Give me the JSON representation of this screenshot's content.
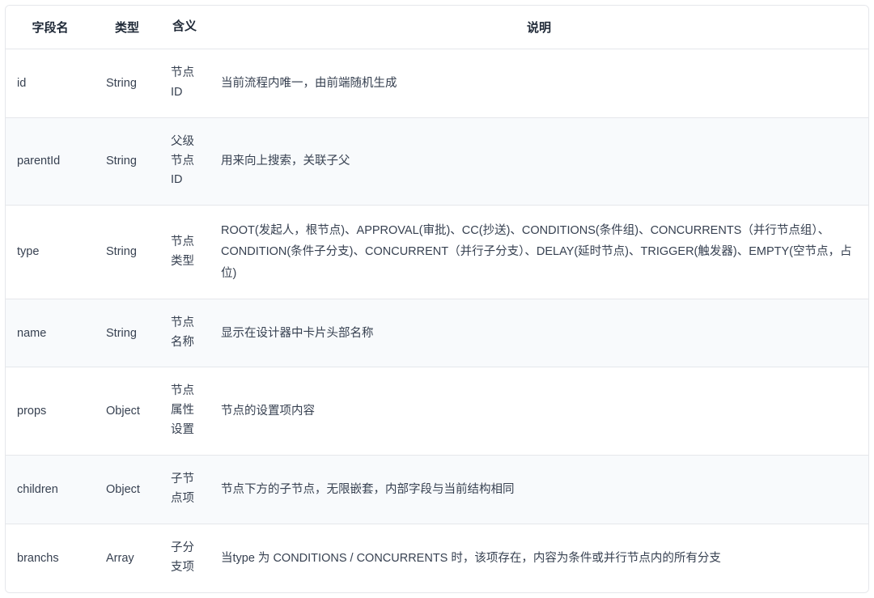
{
  "headers": {
    "field": "字段名",
    "type": "类型",
    "meaning": "含义",
    "description": "说明"
  },
  "rows": [
    {
      "field": "id",
      "type": "String",
      "meaning": "节点ID",
      "description": "当前流程内唯一，由前端随机生成"
    },
    {
      "field": "parentId",
      "type": "String",
      "meaning": "父级节点ID",
      "description": "用来向上搜索，关联子父"
    },
    {
      "field": "type",
      "type": "String",
      "meaning": "节点类型",
      "description": "ROOT(发起人，根节点)、APPROVAL(审批)、CC(抄送)、CONDITIONS(条件组)、CONCURRENTS（并行节点组）、CONDITION(条件子分支)、CONCURRENT（并行子分支）、DELAY(延时节点)、TRIGGER(触发器)、EMPTY(空节点，占位)"
    },
    {
      "field": "name",
      "type": "String",
      "meaning": "节点名称",
      "description": "显示在设计器中卡片头部名称"
    },
    {
      "field": "props",
      "type": "Object",
      "meaning": "节点属性设置",
      "description": "节点的设置项内容"
    },
    {
      "field": "children",
      "type": "Object",
      "meaning": "子节点项",
      "description": "节点下方的子节点，无限嵌套，内部字段与当前结构相同"
    },
    {
      "field": "branchs",
      "type": "Array",
      "meaning": "子分支项",
      "description": "当type 为 CONDITIONS / CONCURRENTS 时，该项存在，内容为条件或并行节点内的所有分支"
    }
  ]
}
